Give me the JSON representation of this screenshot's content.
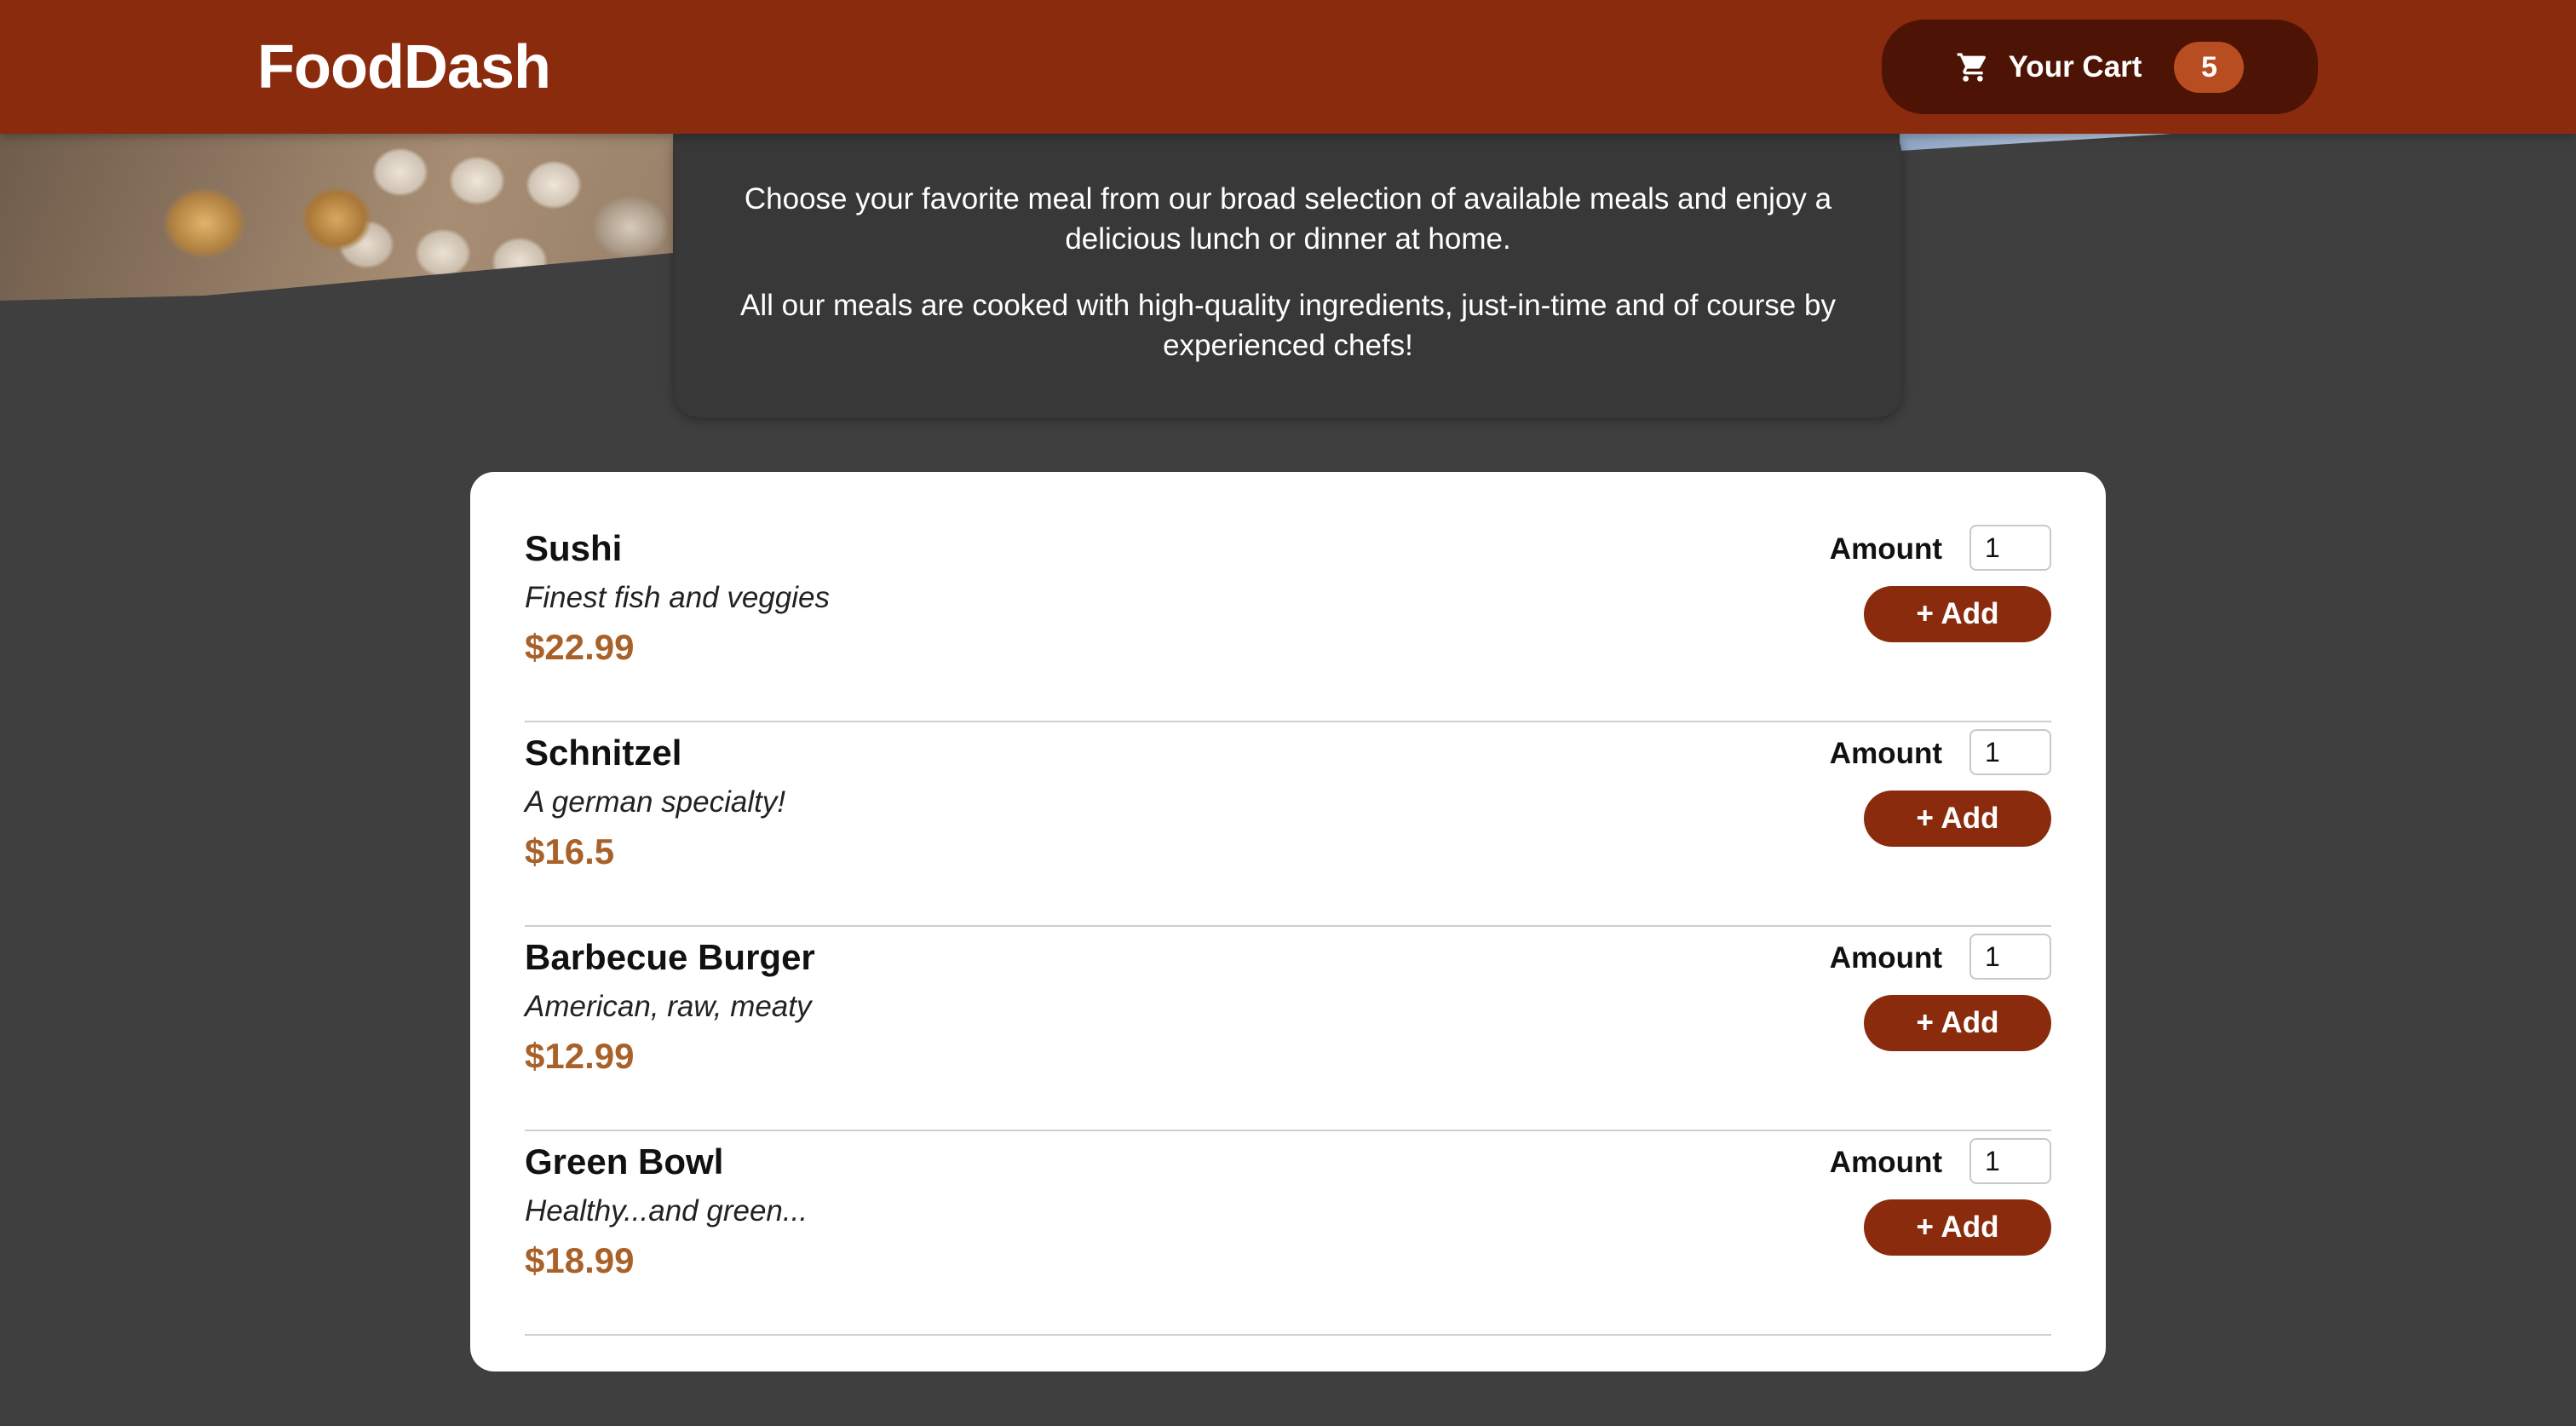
{
  "header": {
    "logo": "FoodDash",
    "cart": {
      "label": "Your Cart",
      "count": "5",
      "icon": "cart-icon"
    }
  },
  "summary": {
    "paragraphs": [
      "Choose your favorite meal from our broad selection of available meals and enjoy a delicious lunch or dinner at home.",
      "All our meals are cooked with high-quality ingredients, just-in-time and of course by experienced chefs!"
    ]
  },
  "meals": {
    "amount_label": "Amount",
    "add_label": "+ Add",
    "items": [
      {
        "name": "Sushi",
        "description": "Finest fish and veggies",
        "price": "$22.99",
        "amount": "1"
      },
      {
        "name": "Schnitzel",
        "description": "A german specialty!",
        "price": "$16.5",
        "amount": "1"
      },
      {
        "name": "Barbecue Burger",
        "description": "American, raw, meaty",
        "price": "$12.99",
        "amount": "1"
      },
      {
        "name": "Green Bowl",
        "description": "Healthy...and green...",
        "price": "$18.99",
        "amount": "1"
      }
    ]
  },
  "colors": {
    "header": "#8a2b0e",
    "cart_button": "#4d1304",
    "badge": "#b94d22",
    "price": "#a9612a",
    "background": "#3f3f3f"
  }
}
